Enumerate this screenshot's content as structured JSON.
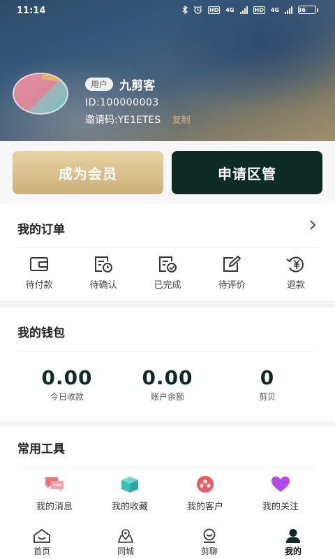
{
  "status_bar": {
    "time": "11:14",
    "network_1": "4G",
    "network_2": "4G",
    "hd_1": "HD",
    "hd_2": "HD",
    "battery": "36"
  },
  "profile": {
    "role_badge": "用户",
    "username": "九剪客",
    "user_id": "ID:100000003",
    "invite_code": "邀请码:YE1ETES",
    "copy_label": "复制"
  },
  "actions": {
    "member_label": "成为会员",
    "area_manager_label": "申请区管"
  },
  "orders": {
    "title": "我的订单",
    "items": [
      {
        "label": "待付款",
        "icon": "wallet-icon"
      },
      {
        "label": "待确认",
        "icon": "clock-document-icon"
      },
      {
        "label": "已完成",
        "icon": "check-document-icon"
      },
      {
        "label": "待评价",
        "icon": "edit-icon"
      },
      {
        "label": "退款",
        "icon": "refund-yen-icon"
      }
    ]
  },
  "wallet": {
    "title": "我的钱包",
    "items": [
      {
        "value": "0.00",
        "label": "今日收款"
      },
      {
        "value": "0.00",
        "label": "账户余额"
      },
      {
        "value": "0",
        "label": "剪贝"
      }
    ]
  },
  "tools": {
    "title": "常用工具",
    "items": [
      {
        "label": "我的消息",
        "icon": "message-icon",
        "color": "#f0707e"
      },
      {
        "label": "我的收藏",
        "icon": "box-icon",
        "color": "#38c2b6"
      },
      {
        "label": "我的客户",
        "icon": "customer-icon",
        "color": "#ea5a63"
      },
      {
        "label": "我的关注",
        "icon": "heart-icon",
        "color": "#b548e8"
      }
    ]
  },
  "bottom_nav": {
    "items": [
      {
        "label": "首页",
        "icon": "home-icon"
      },
      {
        "label": "同城",
        "icon": "map-pin-icon"
      },
      {
        "label": "剪聊",
        "icon": "chat-icon"
      },
      {
        "label": "我的",
        "icon": "user-icon"
      }
    ],
    "active": "我的"
  },
  "colors": {
    "brand_dark": "#0d2a24",
    "gold": "#cdb07a",
    "copy": "#d9b56f"
  }
}
